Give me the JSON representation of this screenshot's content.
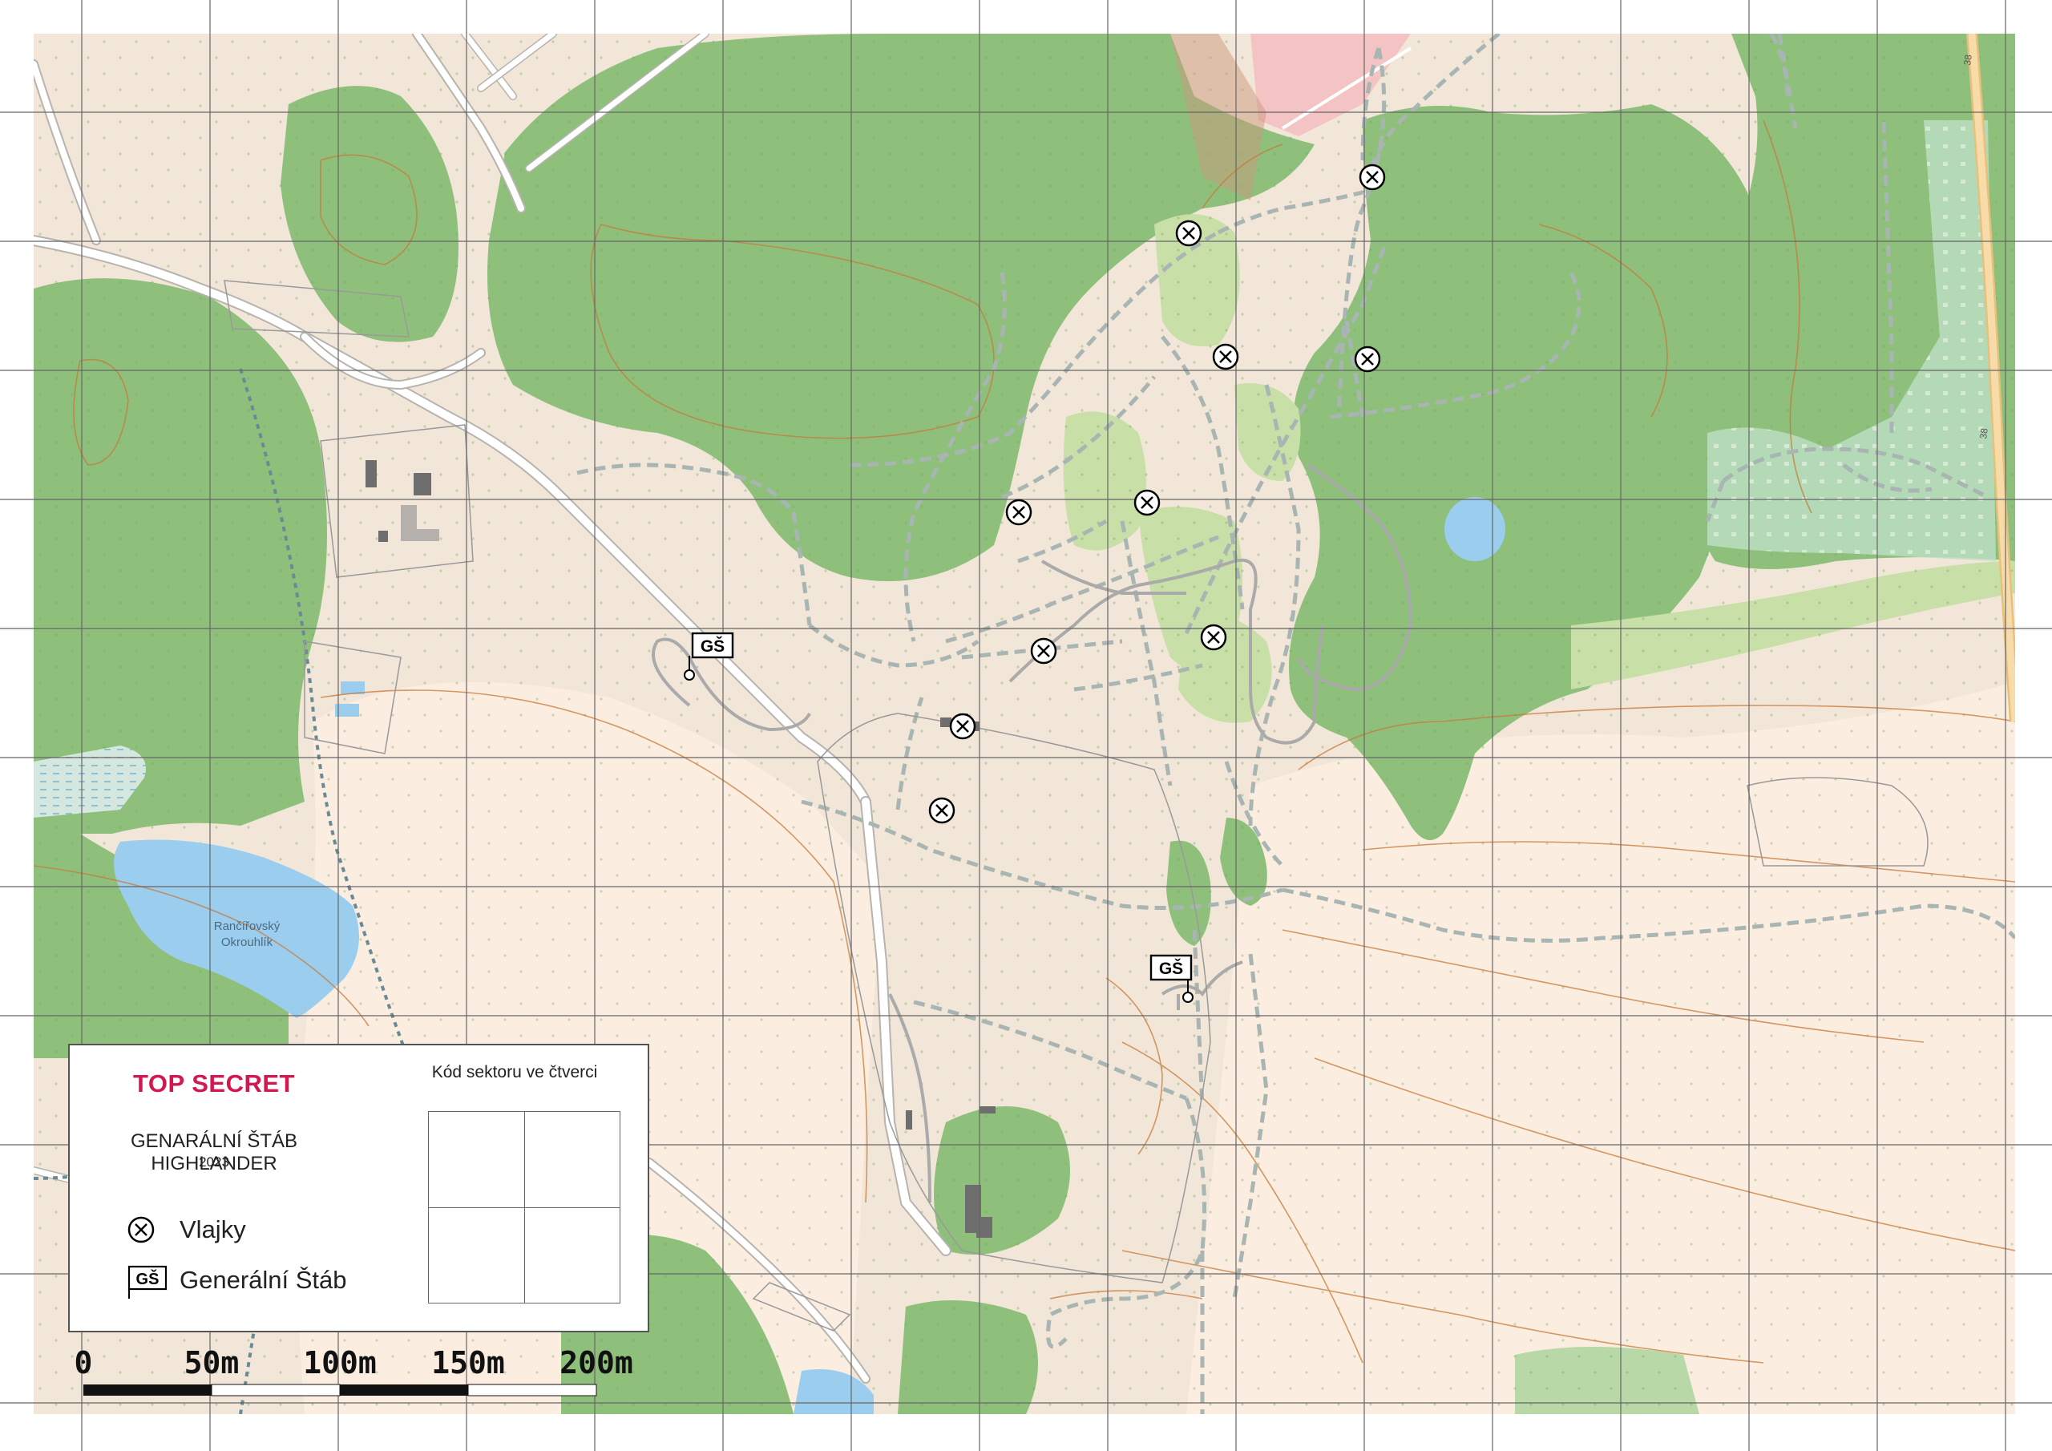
{
  "legend": {
    "title": "TOP SECRET",
    "organization": "GENARÁLNÍ ŠTÁB HIGHLANDER",
    "year": "2023",
    "items": [
      {
        "symbol": "flag-marker-icon",
        "label": "Vlajky"
      },
      {
        "symbol": "hq-flag-icon",
        "label": "Generální Štáb"
      }
    ],
    "sector_code_title": "Kód sektoru ve čtverci"
  },
  "markers": {
    "hq_label": "GŠ"
  },
  "map_labels": {
    "lake_name_line1": "Rančířovský",
    "lake_name_line2": "Okrouhlík",
    "road_number": "38"
  },
  "scale_bar": {
    "labels": [
      "0",
      "50m",
      "100m",
      "150m",
      "200m"
    ]
  },
  "colors": {
    "forest": "#8ec07c",
    "meadow": "#f2e6d8",
    "field": "#fbeee0",
    "water": "#9bcdef",
    "track": "#a8b5b2",
    "grid": "#666666",
    "title_red": "#d3174f"
  }
}
